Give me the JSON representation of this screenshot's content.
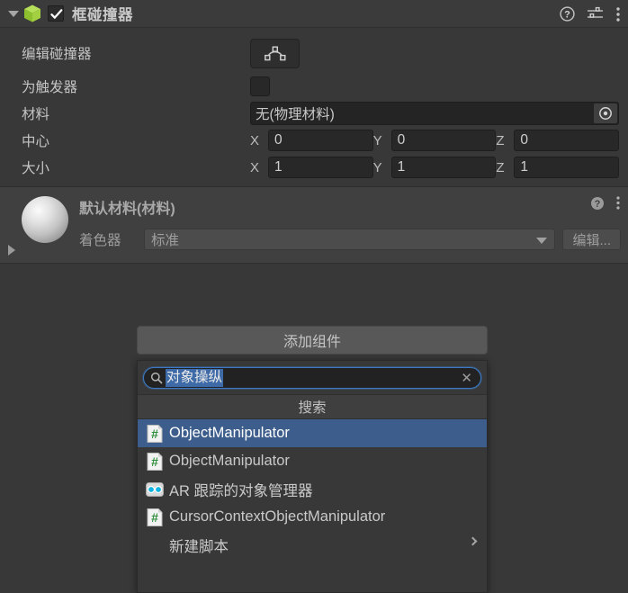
{
  "component_header": {
    "title": "框碰撞器",
    "icon": "box-collider-cube-icon",
    "enabled_checkbox": true,
    "foldout": "expanded",
    "help_icon": "help-question-icon",
    "preset_icon": "preset-settings-icon",
    "menu_icon": "more-vertical-menu-icon"
  },
  "properties": {
    "edit_collider": {
      "label": "编辑碰撞器",
      "button_icon": "edit-collider-polyline-icon"
    },
    "is_trigger": {
      "label": "为触发器",
      "checked": false
    },
    "material": {
      "label": "材料",
      "value": "无(物理材料)",
      "picker_icon": "object-picker-target-icon"
    },
    "center": {
      "label": "中心",
      "axes": [
        "X",
        "Y",
        "Z"
      ],
      "values": [
        "0",
        "0",
        "0"
      ]
    },
    "size": {
      "label": "大小",
      "axes": [
        "X",
        "Y",
        "Z"
      ],
      "values": [
        "1",
        "1",
        "1"
      ]
    }
  },
  "material_block": {
    "title": "默认材料(材料)",
    "preview_icon": "material-sphere-preview",
    "foldout": "collapsed",
    "help_icon": "help-question-icon",
    "menu_icon": "more-vertical-menu-icon",
    "shader": {
      "label": "着色器",
      "value": "标准",
      "edit_label": "编辑..."
    }
  },
  "add_component": {
    "button_label": "添加组件",
    "search": {
      "value": "对象操纵",
      "placeholder": "",
      "selected": true,
      "search_icon": "search-magnifier-icon",
      "clear_icon": "clear-x-icon"
    },
    "results_header": "搜索",
    "results": [
      {
        "name": "ObjectManipulator",
        "icon": "csharp-script-icon",
        "selected": true,
        "has_submenu": false
      },
      {
        "name": "ObjectManipulator",
        "icon": "csharp-script-icon",
        "selected": false,
        "has_submenu": false
      },
      {
        "name": "AR 跟踪的对象管理器",
        "icon": "ar-tracked-object-icon",
        "selected": false,
        "has_submenu": false
      },
      {
        "name": "CursorContextObjectManipulator",
        "icon": "csharp-script-icon",
        "selected": false,
        "has_submenu": false
      },
      {
        "name": "新建脚本",
        "icon": "",
        "selected": false,
        "has_submenu": true
      }
    ]
  },
  "colors": {
    "background": "#383838",
    "header_bg": "#3b3b3b",
    "material_bg": "#404040",
    "selection_blue": "#3d5e8d",
    "focus_blue": "#3b79c4",
    "text": "#c8c8c8",
    "cube_green": "#9acd32"
  }
}
